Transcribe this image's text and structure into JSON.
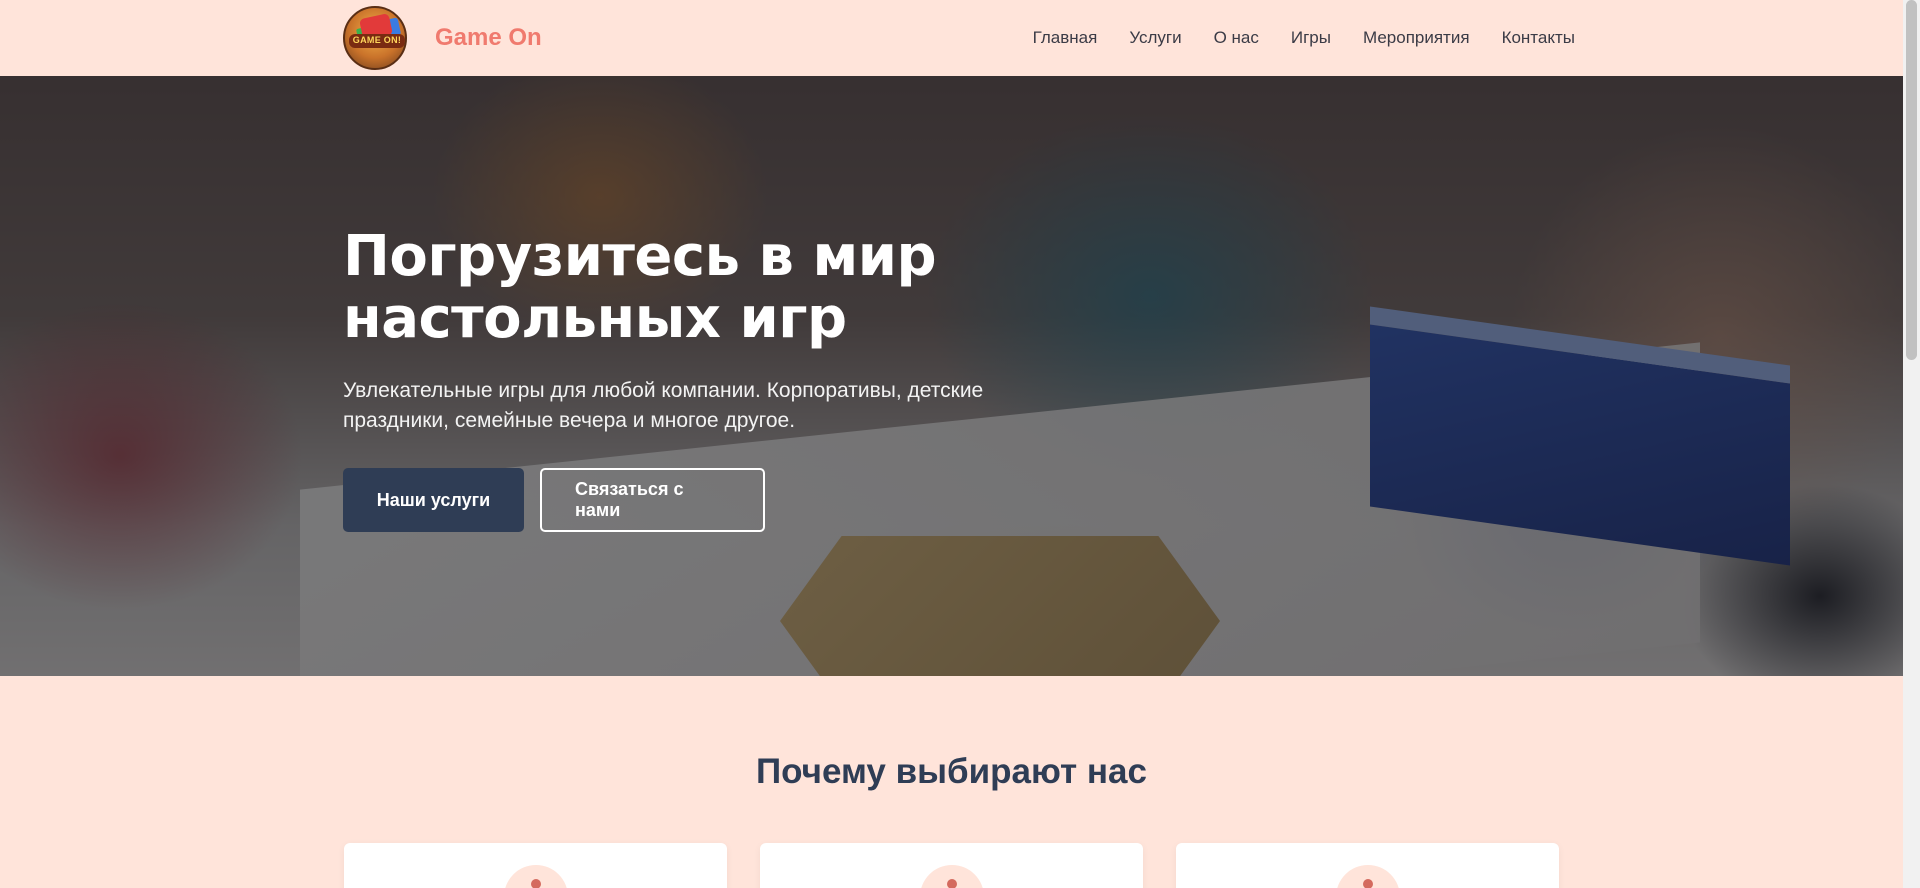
{
  "header": {
    "brand_name": "Game On",
    "logo_text": "GAME ON!",
    "nav": [
      {
        "label": "Главная"
      },
      {
        "label": "Услуги"
      },
      {
        "label": "О нас"
      },
      {
        "label": "Игры"
      },
      {
        "label": "Мероприятия"
      },
      {
        "label": "Контакты"
      }
    ]
  },
  "hero": {
    "title_line1": "Погрузитесь в мир",
    "title_line2": "настольных игр",
    "subtitle": "Увлекательные игры для любой компании. Корпоративы, детские праздники, семейные вечера и многое другое.",
    "primary_button": "Наши услуги",
    "secondary_button": "Связаться с нами"
  },
  "features": {
    "title": "Почему выбирают нас",
    "cards": [
      {
        "icon": "feature-icon"
      },
      {
        "icon": "feature-icon"
      },
      {
        "icon": "feature-icon"
      }
    ]
  },
  "colors": {
    "background": "#ffe4da",
    "brand": "#f07a6e",
    "primary_button": "#2f3d55",
    "heading": "#2f3d55"
  }
}
